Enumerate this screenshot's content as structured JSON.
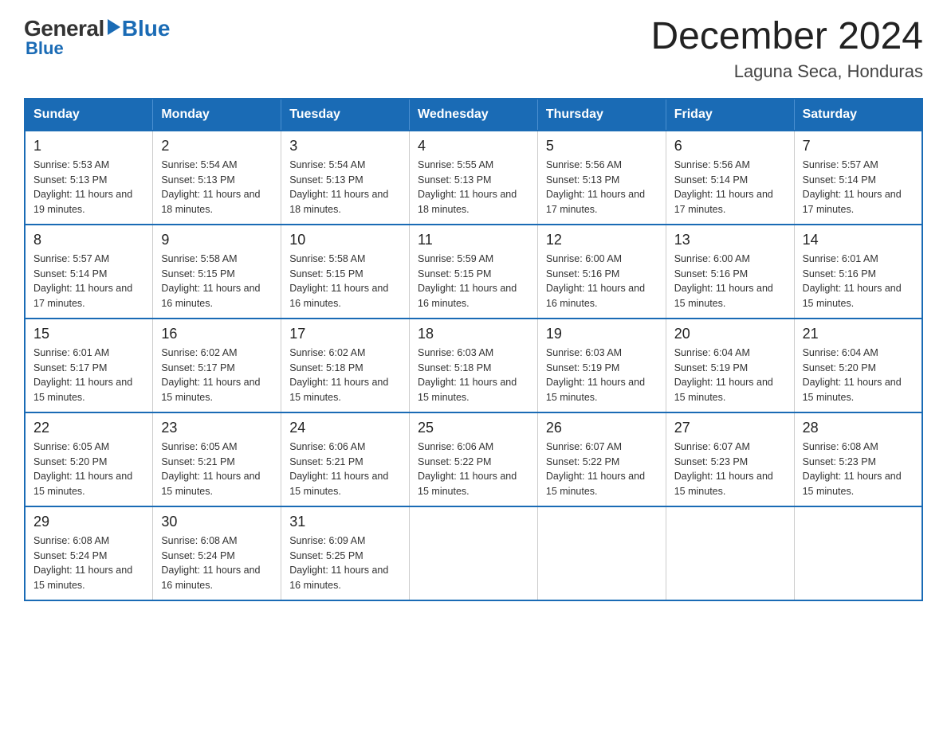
{
  "logo": {
    "general": "General",
    "blue": "Blue"
  },
  "title": "December 2024",
  "location": "Laguna Seca, Honduras",
  "days_of_week": [
    "Sunday",
    "Monday",
    "Tuesday",
    "Wednesday",
    "Thursday",
    "Friday",
    "Saturday"
  ],
  "weeks": [
    [
      {
        "day": "1",
        "sunrise": "5:53 AM",
        "sunset": "5:13 PM",
        "daylight": "11 hours and 19 minutes."
      },
      {
        "day": "2",
        "sunrise": "5:54 AM",
        "sunset": "5:13 PM",
        "daylight": "11 hours and 18 minutes."
      },
      {
        "day": "3",
        "sunrise": "5:54 AM",
        "sunset": "5:13 PM",
        "daylight": "11 hours and 18 minutes."
      },
      {
        "day": "4",
        "sunrise": "5:55 AM",
        "sunset": "5:13 PM",
        "daylight": "11 hours and 18 minutes."
      },
      {
        "day": "5",
        "sunrise": "5:56 AM",
        "sunset": "5:13 PM",
        "daylight": "11 hours and 17 minutes."
      },
      {
        "day": "6",
        "sunrise": "5:56 AM",
        "sunset": "5:14 PM",
        "daylight": "11 hours and 17 minutes."
      },
      {
        "day": "7",
        "sunrise": "5:57 AM",
        "sunset": "5:14 PM",
        "daylight": "11 hours and 17 minutes."
      }
    ],
    [
      {
        "day": "8",
        "sunrise": "5:57 AM",
        "sunset": "5:14 PM",
        "daylight": "11 hours and 17 minutes."
      },
      {
        "day": "9",
        "sunrise": "5:58 AM",
        "sunset": "5:15 PM",
        "daylight": "11 hours and 16 minutes."
      },
      {
        "day": "10",
        "sunrise": "5:58 AM",
        "sunset": "5:15 PM",
        "daylight": "11 hours and 16 minutes."
      },
      {
        "day": "11",
        "sunrise": "5:59 AM",
        "sunset": "5:15 PM",
        "daylight": "11 hours and 16 minutes."
      },
      {
        "day": "12",
        "sunrise": "6:00 AM",
        "sunset": "5:16 PM",
        "daylight": "11 hours and 16 minutes."
      },
      {
        "day": "13",
        "sunrise": "6:00 AM",
        "sunset": "5:16 PM",
        "daylight": "11 hours and 15 minutes."
      },
      {
        "day": "14",
        "sunrise": "6:01 AM",
        "sunset": "5:16 PM",
        "daylight": "11 hours and 15 minutes."
      }
    ],
    [
      {
        "day": "15",
        "sunrise": "6:01 AM",
        "sunset": "5:17 PM",
        "daylight": "11 hours and 15 minutes."
      },
      {
        "day": "16",
        "sunrise": "6:02 AM",
        "sunset": "5:17 PM",
        "daylight": "11 hours and 15 minutes."
      },
      {
        "day": "17",
        "sunrise": "6:02 AM",
        "sunset": "5:18 PM",
        "daylight": "11 hours and 15 minutes."
      },
      {
        "day": "18",
        "sunrise": "6:03 AM",
        "sunset": "5:18 PM",
        "daylight": "11 hours and 15 minutes."
      },
      {
        "day": "19",
        "sunrise": "6:03 AM",
        "sunset": "5:19 PM",
        "daylight": "11 hours and 15 minutes."
      },
      {
        "day": "20",
        "sunrise": "6:04 AM",
        "sunset": "5:19 PM",
        "daylight": "11 hours and 15 minutes."
      },
      {
        "day": "21",
        "sunrise": "6:04 AM",
        "sunset": "5:20 PM",
        "daylight": "11 hours and 15 minutes."
      }
    ],
    [
      {
        "day": "22",
        "sunrise": "6:05 AM",
        "sunset": "5:20 PM",
        "daylight": "11 hours and 15 minutes."
      },
      {
        "day": "23",
        "sunrise": "6:05 AM",
        "sunset": "5:21 PM",
        "daylight": "11 hours and 15 minutes."
      },
      {
        "day": "24",
        "sunrise": "6:06 AM",
        "sunset": "5:21 PM",
        "daylight": "11 hours and 15 minutes."
      },
      {
        "day": "25",
        "sunrise": "6:06 AM",
        "sunset": "5:22 PM",
        "daylight": "11 hours and 15 minutes."
      },
      {
        "day": "26",
        "sunrise": "6:07 AM",
        "sunset": "5:22 PM",
        "daylight": "11 hours and 15 minutes."
      },
      {
        "day": "27",
        "sunrise": "6:07 AM",
        "sunset": "5:23 PM",
        "daylight": "11 hours and 15 minutes."
      },
      {
        "day": "28",
        "sunrise": "6:08 AM",
        "sunset": "5:23 PM",
        "daylight": "11 hours and 15 minutes."
      }
    ],
    [
      {
        "day": "29",
        "sunrise": "6:08 AM",
        "sunset": "5:24 PM",
        "daylight": "11 hours and 15 minutes."
      },
      {
        "day": "30",
        "sunrise": "6:08 AM",
        "sunset": "5:24 PM",
        "daylight": "11 hours and 16 minutes."
      },
      {
        "day": "31",
        "sunrise": "6:09 AM",
        "sunset": "5:25 PM",
        "daylight": "11 hours and 16 minutes."
      },
      null,
      null,
      null,
      null
    ]
  ]
}
